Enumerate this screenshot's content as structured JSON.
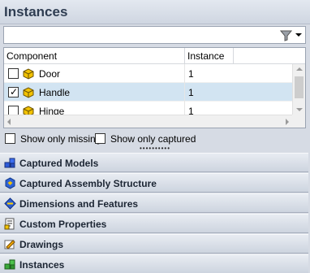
{
  "panel": {
    "title": "Instances"
  },
  "filter": {
    "value": "",
    "placeholder": ""
  },
  "grid": {
    "columns": [
      "Component",
      "Instance"
    ],
    "rows": [
      {
        "checked": false,
        "component": "Door",
        "instance": "1"
      },
      {
        "checked": true,
        "component": "Handle",
        "instance": "1"
      },
      {
        "checked": false,
        "component": "Hinge",
        "instance": "1"
      }
    ]
  },
  "options": {
    "show_only_missing": "Show only missing",
    "show_only_captured": "Show only captured"
  },
  "splitter": "••••••••••",
  "sections": [
    {
      "label": "Captured Models",
      "icon": "captured-models-icon"
    },
    {
      "label": "Captured Assembly Structure",
      "icon": "assembly-structure-icon"
    },
    {
      "label": "Dimensions and Features",
      "icon": "dimensions-icon"
    },
    {
      "label": "Custom Properties",
      "icon": "custom-properties-icon"
    },
    {
      "label": "Drawings",
      "icon": "drawings-icon"
    },
    {
      "label": "Instances",
      "icon": "instances-icon"
    }
  ],
  "colors": {
    "selected_row": "#d2e4f2",
    "header_text": "#2f3d52"
  }
}
